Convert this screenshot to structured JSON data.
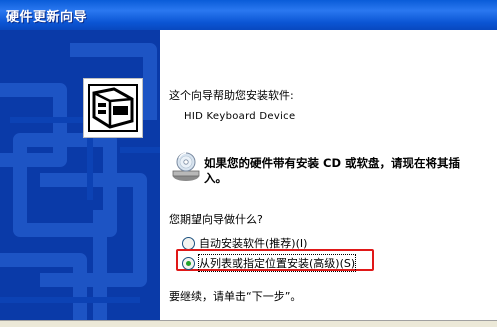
{
  "window": {
    "title": "硬件更新向导"
  },
  "wizard": {
    "intro": "这个向导帮助您安装软件:",
    "device_name": "HID Keyboard Device",
    "cd_prompt": "如果您的硬件带有安装 CD 或软盘，请现在将其插入。",
    "question": "您期望向导做什么?",
    "options": [
      {
        "label": "自动安装软件(推荐)(I)",
        "selected": false
      },
      {
        "label": "从列表或指定位置安装(高级)(S)",
        "selected": true
      }
    ],
    "continue_text": "要继续，请单击“下一步”。"
  },
  "colors": {
    "titlebar": "#0a5cd8",
    "sidepanel": "#0a3aa8",
    "highlight": "#e01818",
    "radio_selected": "#22a22a"
  },
  "icons": {
    "wizard": "hardware-card-icon",
    "cd": "cd-drive-icon"
  }
}
